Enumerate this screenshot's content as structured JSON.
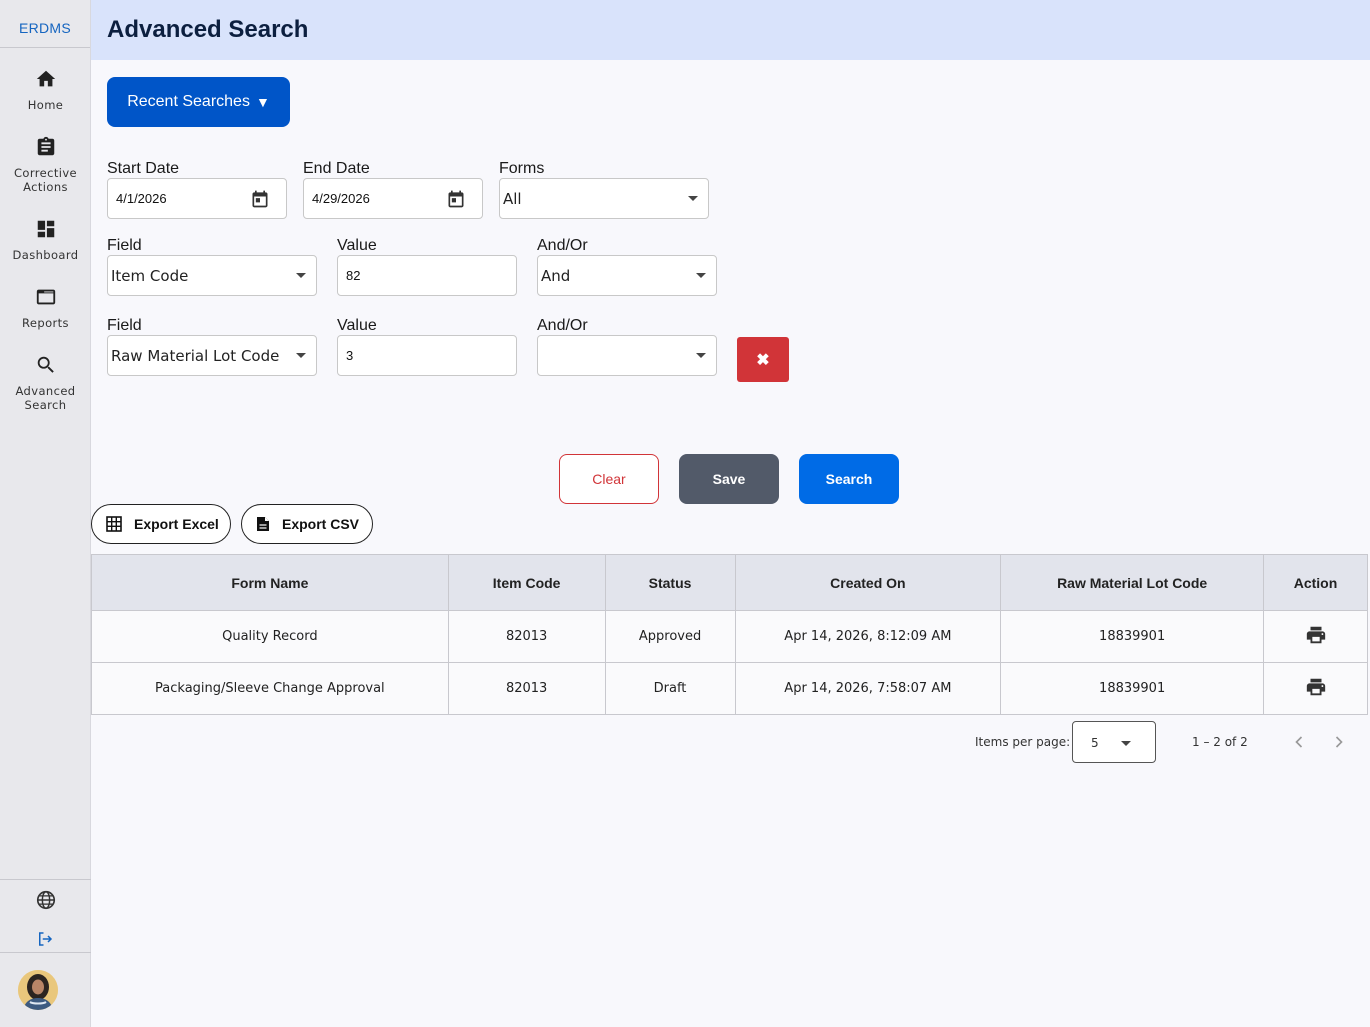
{
  "app": {
    "brand": "ERDMS",
    "title": "Advanced Search"
  },
  "sidebar": {
    "items": [
      {
        "label": "Home",
        "icon": "home-icon"
      },
      {
        "label": "Corrective Actions",
        "icon": "clipboard-icon"
      },
      {
        "label": "Dashboard",
        "icon": "dashboard-icon"
      },
      {
        "label": "Reports",
        "icon": "reports-icon"
      },
      {
        "label": "Advanced Search",
        "icon": "search-icon"
      }
    ],
    "bottom": [
      "globe-icon",
      "logout-icon"
    ]
  },
  "recent_searches": {
    "label": "Recent Searches",
    "icon": "▼"
  },
  "filters": {
    "start_date": {
      "label": "Start Date",
      "value": "4/1/2026"
    },
    "end_date": {
      "label": "End Date",
      "value": "4/29/2026"
    },
    "forms": {
      "label": "Forms",
      "value": "All"
    },
    "rows": [
      {
        "field_label": "Field",
        "field_value": "Item Code",
        "value_label": "Value",
        "value": "82",
        "andor_label": "And/Or",
        "andor_value": "And"
      },
      {
        "field_label": "Field",
        "field_value": "Raw Material Lot Code",
        "value_label": "Value",
        "value": "3",
        "andor_label": "And/Or",
        "andor_value": ""
      }
    ],
    "remove_icon": "✖"
  },
  "actions": {
    "clear": "Clear",
    "save": "Save",
    "search": "Search"
  },
  "exports": {
    "excel": "Export Excel",
    "csv": "Export CSV"
  },
  "table": {
    "headers": [
      "Form Name",
      "Item Code",
      "Status",
      "Created On",
      "Raw Material Lot Code",
      "Action"
    ],
    "rows": [
      {
        "form_name": "Quality Record",
        "item_code": "82013",
        "status": "Approved",
        "created_on": "Apr 14, 2026, 8:12:09 AM",
        "lot_code": "18839901"
      },
      {
        "form_name": "Packaging/Sleeve Change Approval",
        "item_code": "82013",
        "status": "Draft",
        "created_on": "Apr 14, 2026, 7:58:07 AM",
        "lot_code": "18839901"
      }
    ]
  },
  "pagination": {
    "items_per_page_label": "Items per page:",
    "items_per_page": "5",
    "range": "1 – 2 of 2"
  },
  "colors": {
    "primary": "#0055c8",
    "search": "#006be6",
    "danger": "#d13438",
    "header_bg": "#d9e3fb"
  }
}
